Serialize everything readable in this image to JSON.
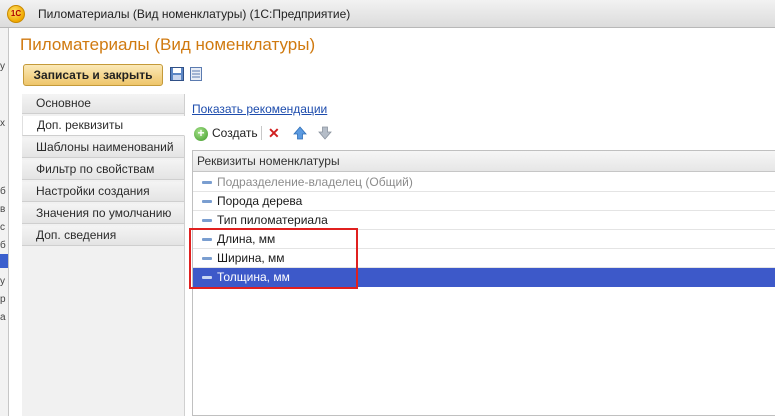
{
  "window": {
    "logo_text": "1С",
    "title": "Пиломатериалы (Вид номенклатуры)  (1С:Предприятие)"
  },
  "form": {
    "title": "Пиломатериалы (Вид номенклатуры)",
    "save_close_label": "Записать и закрыть"
  },
  "nav": {
    "items": [
      {
        "label": "Основное"
      },
      {
        "label": "Доп. реквизиты"
      },
      {
        "label": "Шаблоны наименований"
      },
      {
        "label": "Фильтр по свойствам"
      },
      {
        "label": "Настройки создания"
      },
      {
        "label": "Значения по умолчанию"
      },
      {
        "label": "Доп. сведения"
      }
    ]
  },
  "panel": {
    "link_label": "Показать рекомендации",
    "create_label": "Создать",
    "table": {
      "header": "Реквизиты номенклатуры",
      "rows": [
        {
          "label": "Подразделение-владелец (Общий)"
        },
        {
          "label": "Порода дерева"
        },
        {
          "label": "Тип пиломатериала"
        },
        {
          "label": "Длина, мм"
        },
        {
          "label": "Ширина, мм"
        },
        {
          "label": "Толщина, мм"
        }
      ]
    }
  },
  "left_strip": {
    "chars": [
      "у",
      "х",
      "б",
      "в",
      "с",
      "б",
      "у",
      "р",
      "а"
    ]
  },
  "colors": {
    "accent_title": "#d07a10",
    "selection": "#3d59c9",
    "highlight_box": "#e0201f",
    "link": "#1d4cad"
  },
  "icons": [
    "app-logo-icon",
    "save-disk-icon",
    "list-icon",
    "plus-icon",
    "delete-icon",
    "move-up-icon",
    "move-down-icon",
    "mouse-cursor-icon",
    "row-dash-icon"
  ]
}
